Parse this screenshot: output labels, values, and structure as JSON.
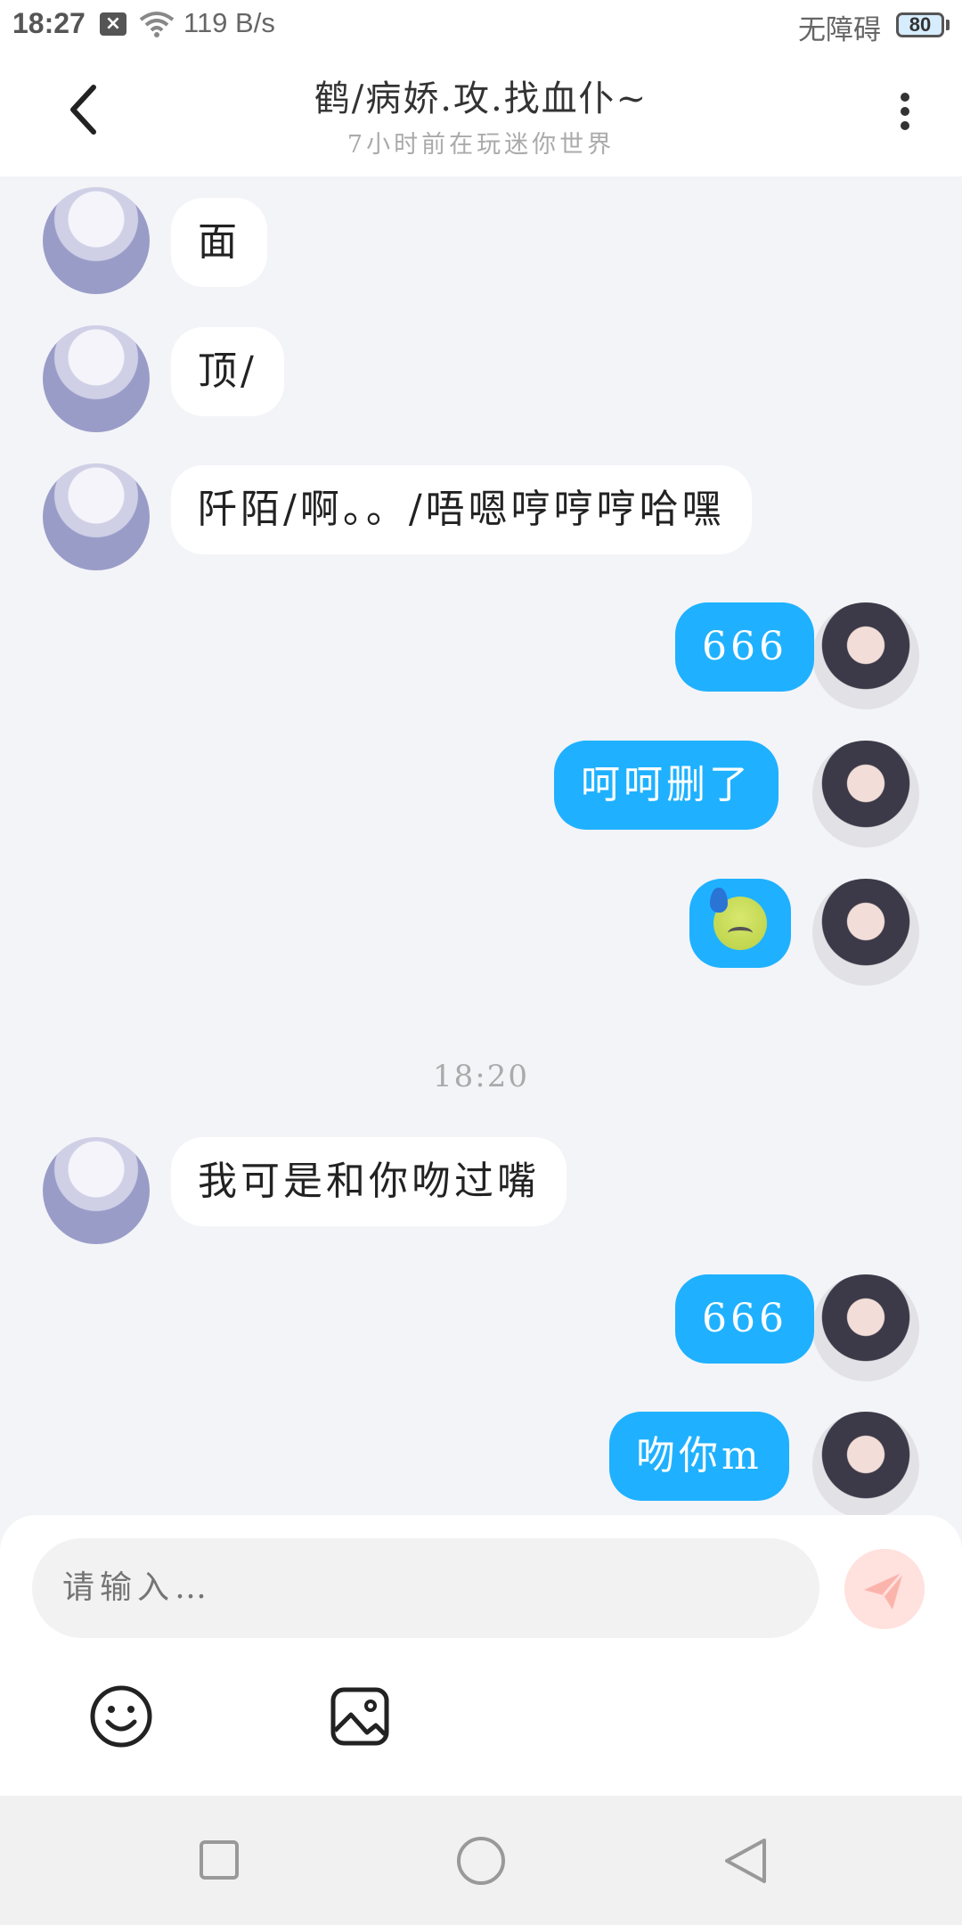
{
  "status_bar": {
    "time": "18:27",
    "notification_badge": "×",
    "network_speed": "119 B/s",
    "accessibility": "无障碍",
    "battery": "80"
  },
  "header": {
    "title": "鹤/病娇.攻.找血仆~",
    "subtitle": "7小时前在玩迷你世界"
  },
  "messages": [
    {
      "side": "left",
      "text": "面"
    },
    {
      "side": "left",
      "text": "顶/"
    },
    {
      "side": "left",
      "text": "阡陌/啊。。/唔嗯哼哼哼哈嘿"
    },
    {
      "side": "right",
      "text": "666"
    },
    {
      "side": "right",
      "text": "呵呵删了"
    },
    {
      "side": "right",
      "text": "",
      "emoji": "cold-sweat-face"
    },
    {
      "side": "left",
      "text": "我可是和你吻过嘴"
    },
    {
      "side": "right",
      "text": "666"
    },
    {
      "side": "right",
      "text": "吻你m"
    }
  ],
  "timestamp": "18:20",
  "composer": {
    "placeholder": "请输入…"
  },
  "colors": {
    "bubble_right": "#1fb1ff",
    "bubble_left": "#ffffff",
    "background": "#f3f4f8",
    "send_button": "#ffe0dd"
  }
}
